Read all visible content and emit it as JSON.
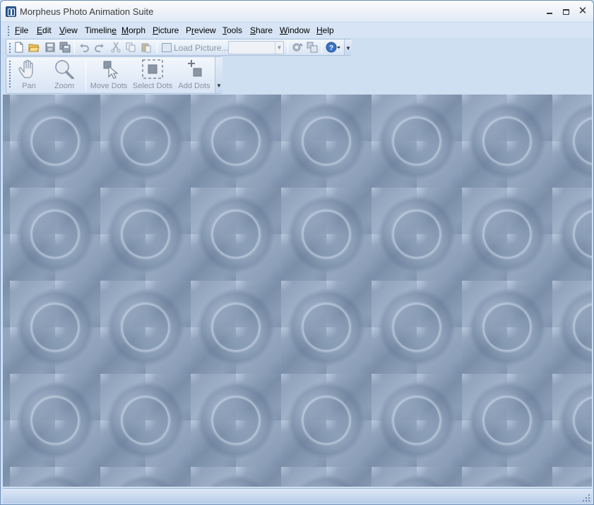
{
  "window": {
    "title": "Morpheus Photo Animation Suite"
  },
  "menu": {
    "items": [
      {
        "label": "File",
        "ul": "F",
        "rest": "ile"
      },
      {
        "label": "Edit",
        "ul": "E",
        "rest": "dit"
      },
      {
        "label": "View",
        "ul": "V",
        "rest": "iew"
      },
      {
        "label": "Timeline",
        "ul_pre": "Timelin",
        "ul": "e",
        "rest": ""
      },
      {
        "label": "Morph",
        "ul": "M",
        "rest": "orph"
      },
      {
        "label": "Picture",
        "ul": "P",
        "rest": "icture"
      },
      {
        "label": "Preview",
        "ul_pre": "P",
        "ul": "r",
        "rest": "eview"
      },
      {
        "label": "Tools",
        "ul": "T",
        "rest": "ools"
      },
      {
        "label": "Share",
        "ul": "S",
        "rest": "hare"
      },
      {
        "label": "Window",
        "ul": "W",
        "rest": "indow"
      },
      {
        "label": "Help",
        "ul": "H",
        "rest": "elp"
      }
    ]
  },
  "toolbar": {
    "load_picture_label": "Load Picture...",
    "combo_value": ""
  },
  "morph_toolbar": {
    "pan_label": "Pan",
    "zoom_label": "Zoom",
    "move_dots_label": "Move Dots",
    "select_dots_label": "Select Dots",
    "add_dots_label": "Add Dots"
  },
  "icons": {
    "new": "new-document-icon",
    "open": "open-folder-icon",
    "save": "save-icon",
    "save_all": "save-all-icon",
    "undo": "undo-icon",
    "redo": "redo-icon",
    "cut": "cut-icon",
    "copy": "copy-icon",
    "paste": "paste-icon",
    "load_picture": "picture-icon",
    "settings": "settings-icon",
    "compare": "compare-icon",
    "help": "help-icon",
    "pan": "hand-icon",
    "zoom": "magnifier-icon",
    "move_dots": "cursor-icon",
    "select_dots": "selection-icon",
    "add_dots": "add-dot-icon"
  },
  "colors": {
    "chrome": "#cfdff2",
    "workspace": "#7f93ad",
    "disabled_text": "#8791a0"
  }
}
